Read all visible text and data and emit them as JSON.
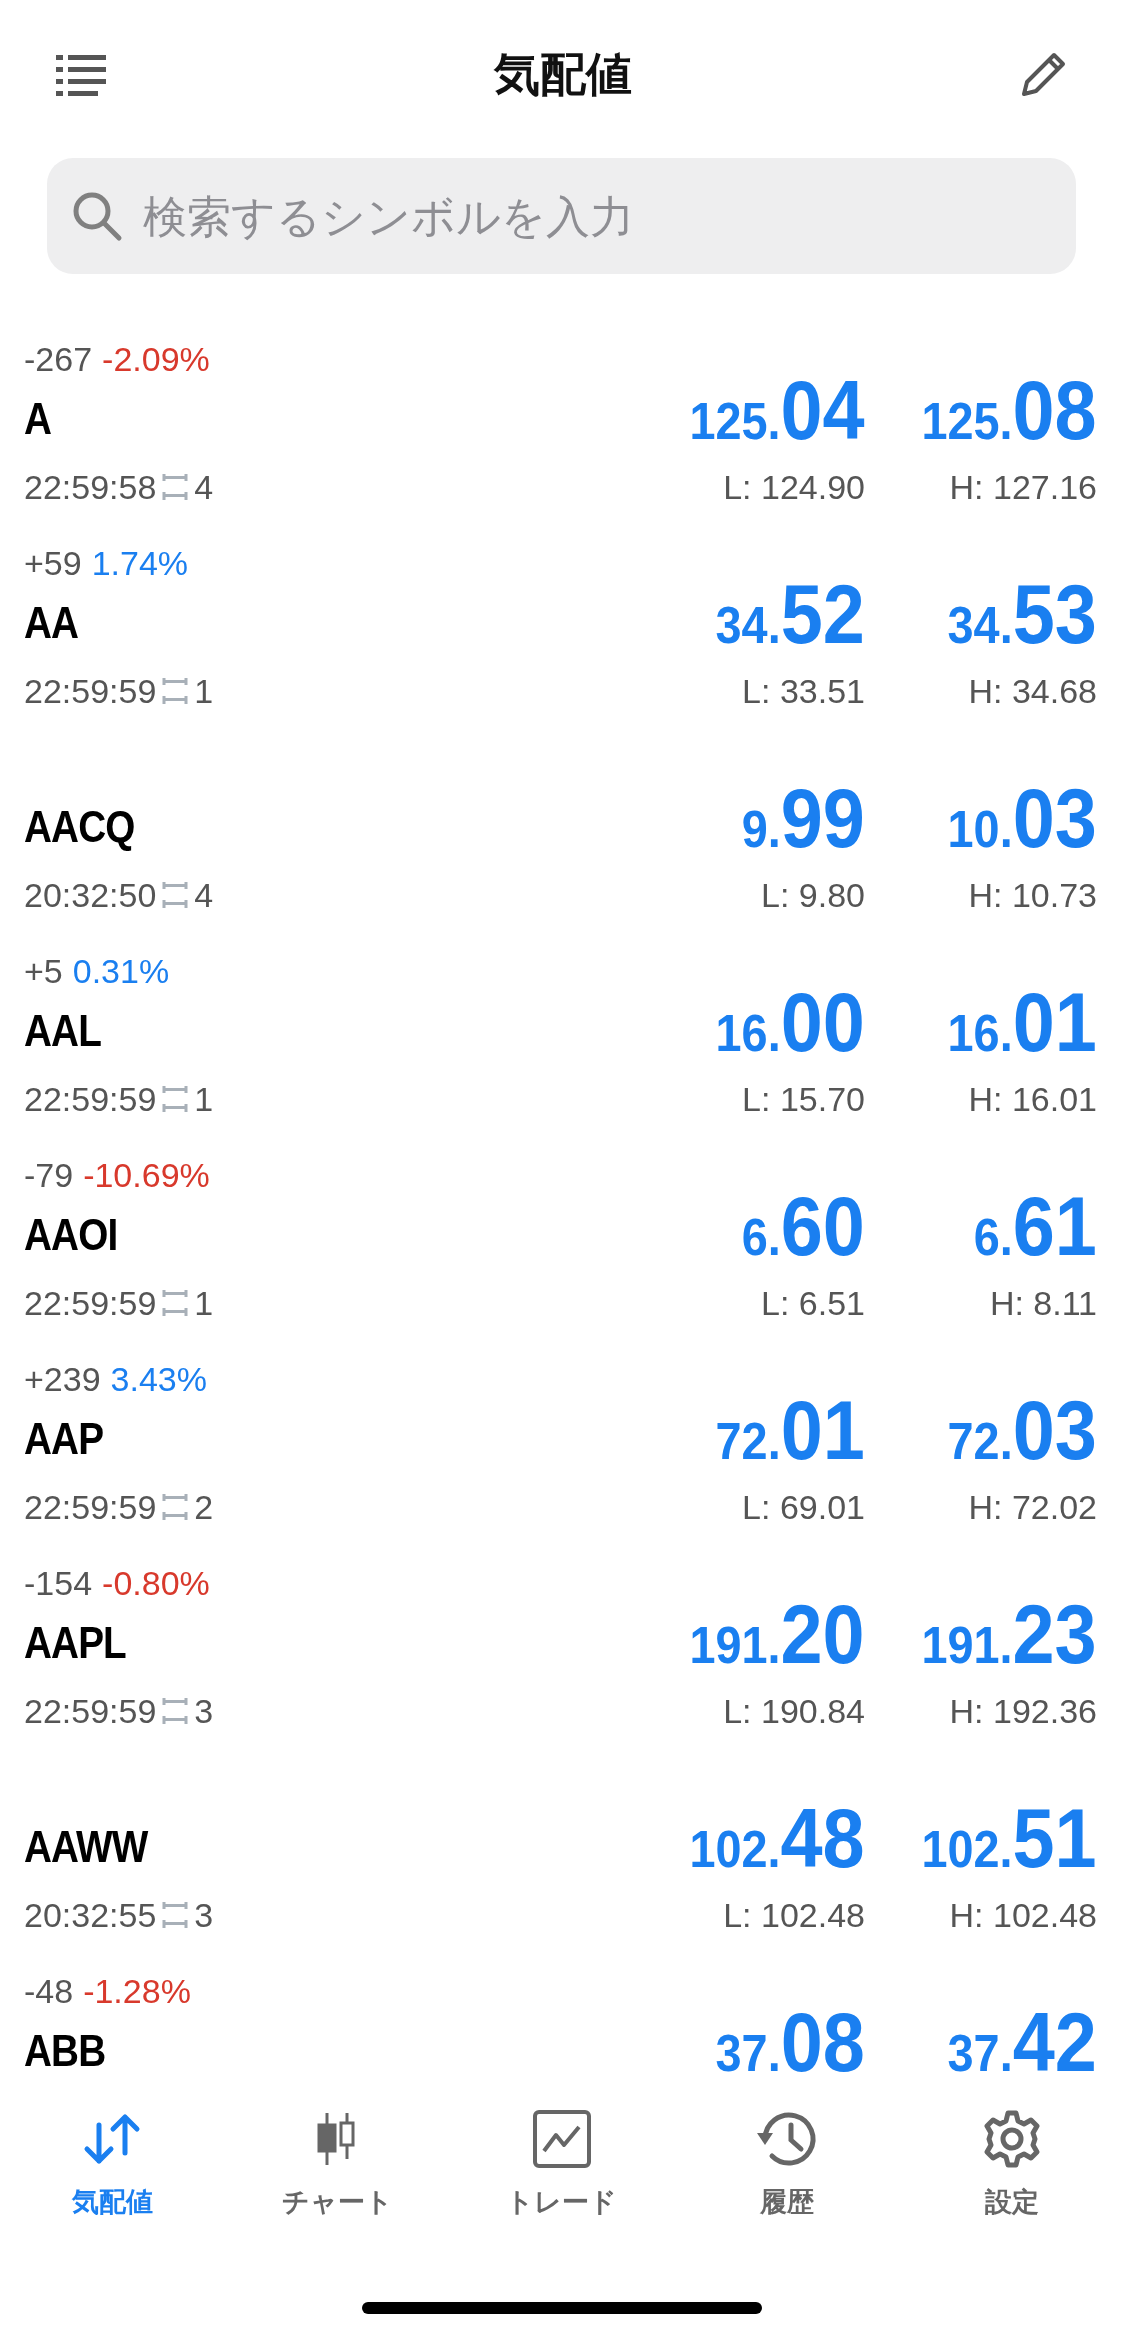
{
  "header": {
    "title": "気配値"
  },
  "search": {
    "placeholder": "検索するシンボルを入力"
  },
  "quotes": [
    {
      "change": "-267",
      "change_pct": "-2.09%",
      "color": "#d8392c",
      "symbol": "A",
      "time": "22:59:58",
      "spread": "4",
      "bid": "125.04",
      "ask": "125.08",
      "low": "L: 124.90",
      "high": "H: 127.16"
    },
    {
      "change": "+59",
      "change_pct": "1.74%",
      "color": "#1a7ff0",
      "symbol": "AA",
      "time": "22:59:59",
      "spread": "1",
      "bid": "34.52",
      "ask": "34.53",
      "low": "L: 33.51",
      "high": "H: 34.68"
    },
    {
      "symbol": "AACQ",
      "time": "20:32:50",
      "spread": "4",
      "bid": "9.99",
      "ask": "10.03",
      "low": "L: 9.80",
      "high": "H: 10.73"
    },
    {
      "change": "+5",
      "change_pct": "0.31%",
      "color": "#1a7ff0",
      "symbol": "AAL",
      "time": "22:59:59",
      "spread": "1",
      "bid": "16.00",
      "ask": "16.01",
      "low": "L: 15.70",
      "high": "H: 16.01"
    },
    {
      "change": "-79",
      "change_pct": "-10.69%",
      "color": "#d8392c",
      "symbol": "AAOI",
      "time": "22:59:59",
      "spread": "1",
      "bid": "6.60",
      "ask": "6.61",
      "low": "L: 6.51",
      "high": "H: 8.11"
    },
    {
      "change": "+239",
      "change_pct": "3.43%",
      "color": "#1a7ff0",
      "symbol": "AAP",
      "time": "22:59:59",
      "spread": "2",
      "bid": "72.01",
      "ask": "72.03",
      "low": "L: 69.01",
      "high": "H: 72.02"
    },
    {
      "change": "-154",
      "change_pct": "-0.80%",
      "color": "#d8392c",
      "symbol": "AAPL",
      "time": "22:59:59",
      "spread": "3",
      "bid": "191.20",
      "ask": "191.23",
      "low": "L: 190.84",
      "high": "H: 192.36"
    },
    {
      "symbol": "AAWW",
      "time": "20:32:55",
      "spread": "3",
      "bid": "102.48",
      "ask": "102.51",
      "low": "L: 102.48",
      "high": "H: 102.48"
    },
    {
      "change": "-48",
      "change_pct": "-1.28%",
      "color": "#d8392c",
      "symbol": "ABB",
      "bid": "37.08",
      "ask": "37.42"
    }
  ],
  "tabs": [
    {
      "label": "気配値",
      "selected": true
    },
    {
      "label": "チャート",
      "selected": false
    },
    {
      "label": "トレード",
      "selected": false
    },
    {
      "label": "履歴",
      "selected": false
    },
    {
      "label": "設定",
      "selected": false
    }
  ]
}
